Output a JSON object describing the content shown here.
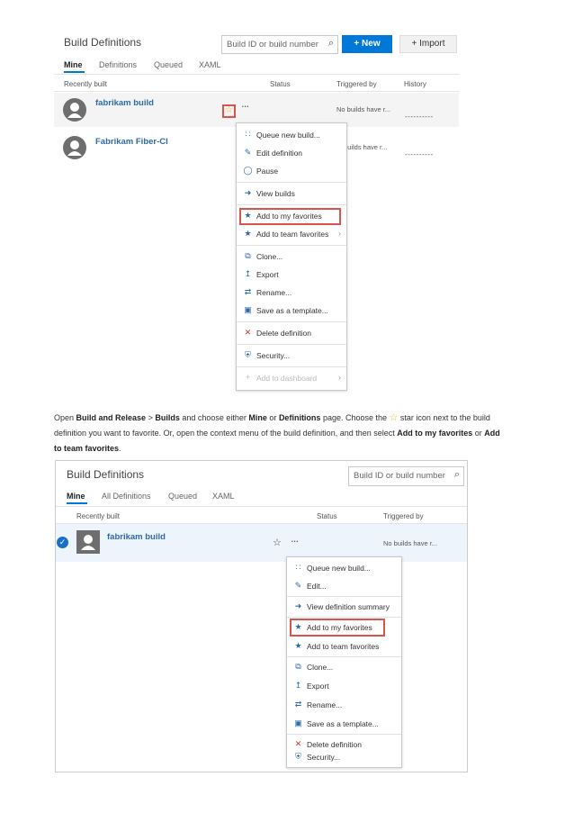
{
  "screenshot1": {
    "title": "Build Definitions",
    "search_placeholder": "Build ID or build number",
    "new_button": "New",
    "import_button": "Import",
    "tabs": [
      "Mine",
      "Definitions",
      "Queued",
      "XAML"
    ],
    "columns": {
      "recently_built": "Recently built",
      "status": "Status",
      "triggered_by": "Triggered by",
      "history": "History"
    },
    "rows": [
      {
        "name": "fabrikam build",
        "triggered": "No builds have r...",
        "history": "----------"
      },
      {
        "name": "Fabrikam Fiber-CI",
        "triggered": "builds have r...",
        "history": "----------"
      }
    ],
    "more_glyph": "•••",
    "menu": [
      {
        "label": "Queue new build...",
        "icon": "queue-icon"
      },
      {
        "label": "Edit definition",
        "icon": "pencil-icon"
      },
      {
        "label": "Pause",
        "icon": "pause-icon"
      },
      {
        "label": "View builds",
        "icon": "arrow-circle-icon"
      },
      {
        "label": "Add to my favorites",
        "icon": "star-icon"
      },
      {
        "label": "Add to team favorites",
        "icon": "star-icon"
      },
      {
        "label": "Clone...",
        "icon": "clone-icon"
      },
      {
        "label": "Export",
        "icon": "export-icon"
      },
      {
        "label": "Rename...",
        "icon": "rename-icon"
      },
      {
        "label": "Save as a template...",
        "icon": "template-icon"
      },
      {
        "label": "Delete definition",
        "icon": "delete-icon"
      },
      {
        "label": "Security...",
        "icon": "shield-icon"
      },
      {
        "label": "Add to dashboard",
        "icon": "plus-icon"
      }
    ]
  },
  "paragraph": {
    "p1": "Open ",
    "b1": "Build and Release",
    "p2": " > ",
    "b2": "Builds",
    "p3": " and choose either ",
    "b3": "Mine",
    "p4": " or ",
    "b4": "Definitions",
    "p5": " page. Choose the ",
    "p6": " star icon next to the build definition you want to favorite. Or, open the context menu of the build definition, and then select ",
    "b5": "Add to my favorites",
    "p7": " or ",
    "b6": "Add to team favorites",
    "p8": "."
  },
  "screenshot2": {
    "title": "Build Definitions",
    "search_placeholder": "Build ID or build number",
    "tabs": [
      "Mine",
      "All Definitions",
      "Queued",
      "XAML"
    ],
    "columns": {
      "recently_built": "Recently built",
      "status": "Status",
      "triggered_by": "Triggered by"
    },
    "row": {
      "name": "fabrikam build",
      "triggered": "No builds have r..."
    },
    "more_glyph": "•••",
    "menu": [
      {
        "label": "Queue new build...",
        "icon": "queue-icon"
      },
      {
        "label": "Edit...",
        "icon": "pencil-icon"
      },
      {
        "label": "View definition summary",
        "icon": "arrow-circle-icon"
      },
      {
        "label": "Add to my favorites",
        "icon": "star-icon"
      },
      {
        "label": "Add to team favorites",
        "icon": "star-icon"
      },
      {
        "label": "Clone...",
        "icon": "clone-icon"
      },
      {
        "label": "Export",
        "icon": "export-icon"
      },
      {
        "label": "Rename...",
        "icon": "rename-icon"
      },
      {
        "label": "Save as a template...",
        "icon": "template-icon"
      },
      {
        "label": "Delete definition",
        "icon": "delete-icon"
      },
      {
        "label": "Security...",
        "icon": "shield-icon"
      }
    ]
  },
  "colors": {
    "accent": "#0078d7",
    "link": "#2c6aa8",
    "highlight": "#d9534f",
    "star": "#f0ad1e"
  }
}
